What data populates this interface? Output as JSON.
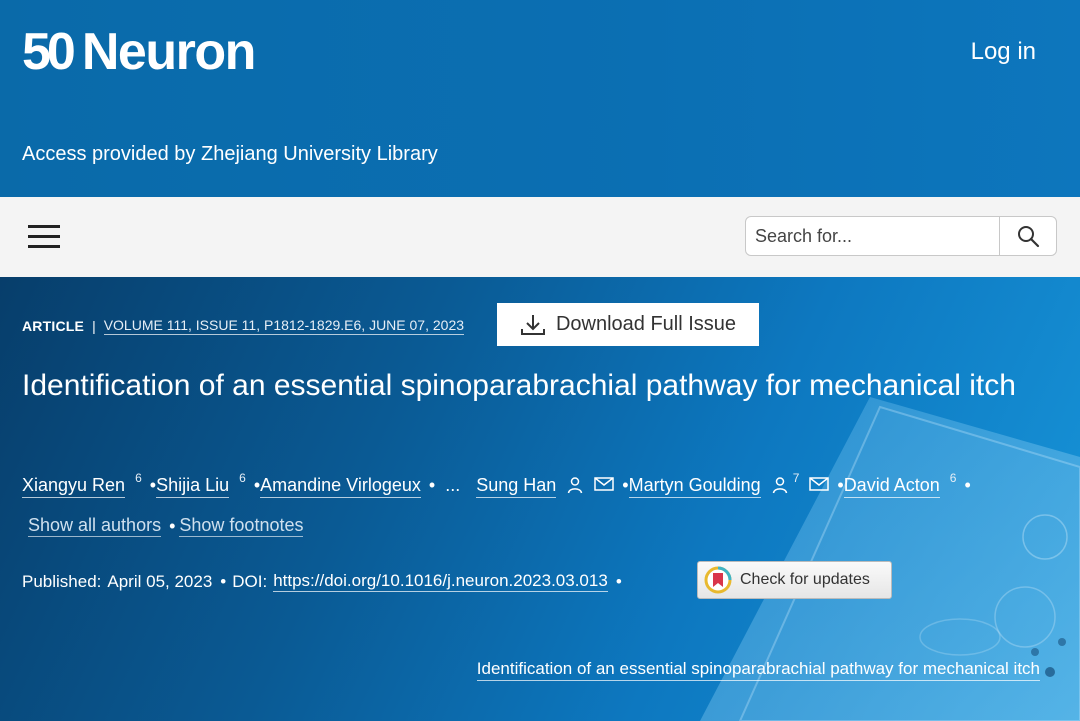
{
  "header": {
    "logo_number": "50",
    "logo_text": "Neuron",
    "login_label": "Log in",
    "access_text": "Access provided by Zhejiang University Library"
  },
  "navbar": {
    "menu_icon": "hamburger-menu-icon",
    "search": {
      "placeholder": "Search for...",
      "value": "",
      "icon": "search-icon"
    }
  },
  "article": {
    "type_label": "ARTICLE",
    "separator": "|",
    "volume_info": "VOLUME 111, ISSUE 11, P1812-1829.E6, JUNE 07, 2023",
    "download_label": "Download Full Issue",
    "title": "Identification of an essential spinoparabrachial pathway for mechanical itch",
    "authors": [
      {
        "name": "Xiangyu Ren",
        "sup": "6"
      },
      {
        "name": "Shijia Liu",
        "sup": "6"
      },
      {
        "name": "Amandine Virlogeux"
      },
      {
        "name": "Sung Han"
      },
      {
        "name": "Martyn Goulding",
        "sup": "7"
      },
      {
        "name": "David Acton",
        "sup": "6"
      }
    ],
    "ellipsis": "...",
    "bullet": "•",
    "show_all_authors": "Show all authors",
    "show_footnotes": "Show footnotes",
    "published_label": "Published:",
    "published_date": "April 05, 2023",
    "doi_label": "DOI:",
    "doi_link": "https://doi.org/10.1016/j.neuron.2023.03.013",
    "check_updates_label": "Check for updates",
    "cover_caption": "Identification of an essential spinoparabrachial pathway for mechanical itch"
  },
  "colors": {
    "header_blue": "#0b6fb3",
    "navbar_bg": "#f4f4f4",
    "hero_dark": "#073e6b",
    "hero_light": "#1896da"
  }
}
